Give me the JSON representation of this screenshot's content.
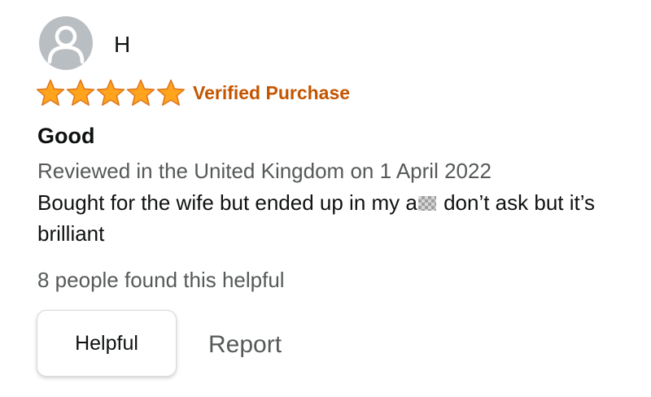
{
  "review": {
    "reviewer_name": "H",
    "rating": 5,
    "max_rating": 5,
    "verified_label": "Verified Purchase",
    "title": "Good",
    "date_line": "Reviewed in the United Kingdom on 1 April 2022",
    "body_part1": "Bought for the wife but ended up in my a",
    "body_part2": " don’t ask but it’s brilliant",
    "helpful_count_text": "8 people found this helpful"
  },
  "actions": {
    "helpful_label": "Helpful",
    "report_label": "Report"
  },
  "colors": {
    "star": "#ffa41c",
    "star_outline": "#de7921",
    "verified": "#c45500",
    "avatar_bg": "#b9bec3",
    "muted_text": "#565959"
  },
  "icons": {
    "avatar": "user-silhouette-icon",
    "star": "star-filled-icon"
  }
}
